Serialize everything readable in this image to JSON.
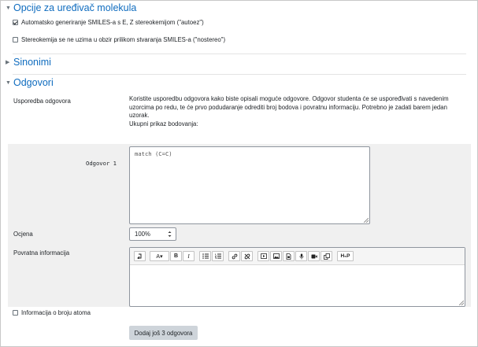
{
  "sections": {
    "molecule_editor": {
      "title": "Opcije za uređivač molekula",
      "expanded": true
    },
    "synonyms": {
      "title": "Sinonimi",
      "expanded": false
    },
    "answers": {
      "title": "Odgovori",
      "expanded": true
    }
  },
  "molecule_options": [
    {
      "label": "Automatsko generiranje SMILES-a s E, Z stereokemijom (\"autoez\")",
      "checked": true
    },
    {
      "label": "Stereokemija se ne uzima u obzir prilikom stvaranja SMILES-a (\"nostereo\")",
      "checked": false
    }
  ],
  "answers": {
    "comparison_label": "Usporedba odgovora",
    "description": "Koristite usporedbu odgovora kako biste opisali moguće odgovore. Odgovor studenta će se uspoređivati s navedenim uzorcima po redu, te će prvo podudaranje odrediti broj bodova i povratnu informaciju. Potrebno je zadati barem jedan uzorak.",
    "summary_label": "Ukupni prikaz bodovanja:",
    "answer_label": "Odgovor 1",
    "answer_value": "match (C=C)",
    "grade_label": "Ocjena",
    "grade_value": "100%",
    "feedback_label": "Povratna informacija",
    "atom_count_label": "Informacija o broju atoma",
    "atom_count_checked": false,
    "add_button": "Dodaj još 3 odgovora"
  },
  "icons": {
    "collapse_expanded": "chevron-down-icon",
    "collapse_collapsed": "chevron-right-icon",
    "select_arrow": "sort-arrows-icon"
  },
  "toolbar_icons": [
    "collapse-toolbar-icon",
    "font-color-icon",
    "bold-icon",
    "italic-icon",
    "unordered-list-icon",
    "ordered-list-icon",
    "link-icon",
    "unlink-icon",
    "media-icon",
    "image-icon",
    "file-icon",
    "record-audio-icon",
    "record-video-icon",
    "manage-files-icon",
    "h5p-icon"
  ],
  "toolbar_labels": {
    "bold": "B",
    "italic": "I",
    "h5p": "H₅P"
  },
  "colors": {
    "accent": "#0f6cbf",
    "panel": "#f0f0f0",
    "button": "#ced4da"
  }
}
